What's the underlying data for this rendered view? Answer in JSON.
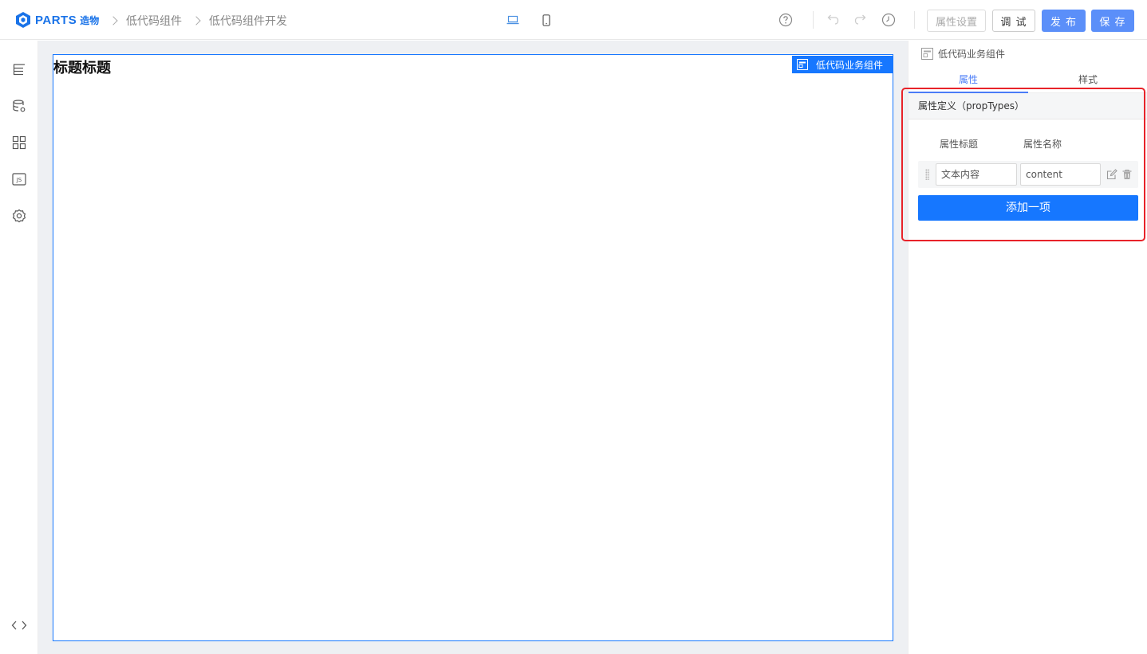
{
  "brand": {
    "name": "PARTS",
    "name_cn": "造物",
    "color": "#1a73e8"
  },
  "breadcrumb": [
    "低代码组件",
    "低代码组件开发"
  ],
  "device_switch": [
    {
      "icon": "laptop-icon",
      "active": true
    },
    {
      "icon": "mobile-icon",
      "active": false
    }
  ],
  "toolbar": {
    "help_icon": "help-icon",
    "undo_icon": "undo-icon",
    "redo_icon": "redo-icon",
    "history_icon": "history-icon",
    "prop_settings_label": "属性设置",
    "debug_label": "调 试",
    "publish_label": "发 布",
    "save_label": "保 存"
  },
  "sidebar": {
    "items": [
      {
        "icon": "outline-tree-icon"
      },
      {
        "icon": "datasource-icon"
      },
      {
        "icon": "components-grid-icon"
      },
      {
        "icon": "js-icon"
      },
      {
        "icon": "settings-icon"
      }
    ],
    "bottom_icon": "code-icon"
  },
  "canvas": {
    "title": "标题标题",
    "component_tag": "低代码业务组件",
    "accent": "#1677ff"
  },
  "panel": {
    "component_name": "低代码业务组件",
    "tabs": [
      {
        "label": "属性",
        "active": true
      },
      {
        "label": "样式",
        "active": false
      }
    ],
    "section_title": "属性定义（propTypes）",
    "columns": {
      "title": "属性标题",
      "name": "属性名称"
    },
    "rows": [
      {
        "title_value": "文本内容",
        "name_value": "content"
      }
    ],
    "add_label": "添加一项"
  },
  "highlight_color": "#e8232a"
}
